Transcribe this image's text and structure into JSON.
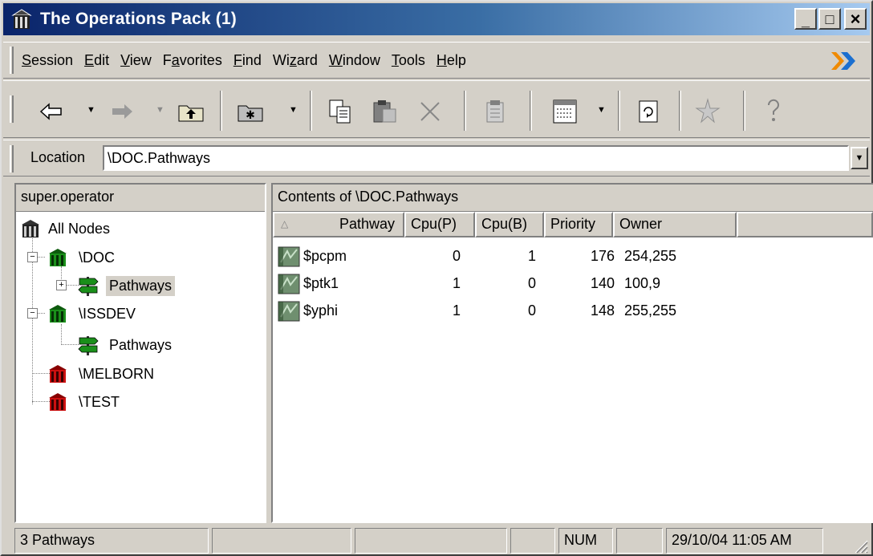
{
  "window": {
    "title": "The Operations Pack (1)",
    "controls": {
      "minimize": "_",
      "maximize": "□",
      "close": "×"
    }
  },
  "menu": [
    {
      "pre": "",
      "key": "S",
      "post": "ession"
    },
    {
      "pre": "",
      "key": "E",
      "post": "dit"
    },
    {
      "pre": "",
      "key": "V",
      "post": "iew"
    },
    {
      "pre": "F",
      "key": "a",
      "post": "vorites"
    },
    {
      "pre": "",
      "key": "F",
      "post": "ind"
    },
    {
      "pre": "Wi",
      "key": "z",
      "post": "ard"
    },
    {
      "pre": "",
      "key": "W",
      "post": "indow"
    },
    {
      "pre": "",
      "key": "T",
      "post": "ools"
    },
    {
      "pre": "",
      "key": "H",
      "post": "elp"
    }
  ],
  "toolbar": {
    "icons": [
      "back-arrow-icon",
      "forward-arrow-icon",
      "up-folder-icon",
      "new-folder-icon",
      "copy-icon",
      "paste-icon",
      "delete-icon",
      "properties-icon",
      "view-list-icon",
      "refresh-icon",
      "wizard-icon",
      "help-icon"
    ]
  },
  "location": {
    "label": "Location",
    "value": "\\DOC.Pathways"
  },
  "tree": {
    "header": "super.operator",
    "nodes": [
      {
        "label": "All Nodes",
        "icon": "building-icon-black"
      },
      {
        "label": "\\DOC",
        "icon": "building-icon-green"
      },
      {
        "label": "Pathways",
        "icon": "signpost-icon",
        "selected": true
      },
      {
        "label": "\\ISSDEV",
        "icon": "building-icon-green"
      },
      {
        "label": "Pathways",
        "icon": "signpost-icon"
      },
      {
        "label": "\\MELBORN",
        "icon": "building-icon-red"
      },
      {
        "label": "\\TEST",
        "icon": "building-icon-red"
      }
    ],
    "expanders": {
      "collapse": "−",
      "expand": "+"
    }
  },
  "contents": {
    "header": "Contents of \\DOC.Pathways",
    "sort_indicator": "△",
    "columns": [
      "Pathway",
      "Cpu(P)",
      "Cpu(B)",
      "Priority",
      "Owner"
    ],
    "rows": [
      {
        "pathway": "$pcpm",
        "cpu_p": "0",
        "cpu_b": "1",
        "priority": "176",
        "owner": "254,255"
      },
      {
        "pathway": "$ptk1",
        "cpu_p": "1",
        "cpu_b": "0",
        "priority": "140",
        "owner": "100,9"
      },
      {
        "pathway": "$yphi",
        "cpu_p": "1",
        "cpu_b": "0",
        "priority": "148",
        "owner": "255,255"
      }
    ]
  },
  "status": {
    "count": "3 Pathways",
    "num": "NUM",
    "datetime": "29/10/04 11:05 AM"
  },
  "colors": {
    "title_start": "#0a246a",
    "title_end": "#a6caf0",
    "face": "#d4d0c8",
    "green_node": "#1a8f1a",
    "red_node": "#cc1010"
  }
}
